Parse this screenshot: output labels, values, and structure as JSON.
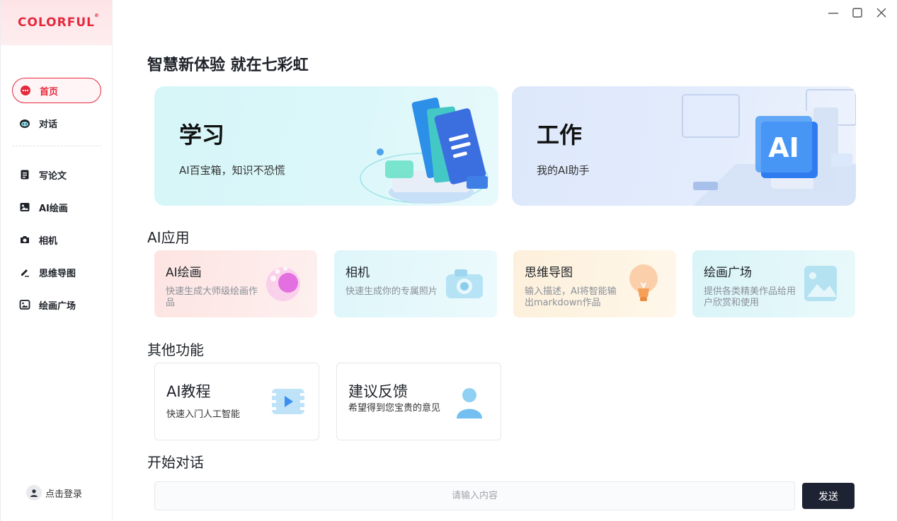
{
  "brand": {
    "logo_text": "COLORFUL",
    "logo_mark": "®",
    "accent": "#e5293d"
  },
  "sidebar": {
    "items": [
      {
        "label": "首页",
        "icon": "chat-bubble-icon",
        "active": true
      },
      {
        "label": "对话",
        "icon": "robot-icon",
        "active": false
      },
      {
        "label": "写论文",
        "icon": "document-icon",
        "active": false
      },
      {
        "label": "AI绘画",
        "icon": "image-icon",
        "active": false
      },
      {
        "label": "相机",
        "icon": "camera-icon",
        "active": false
      },
      {
        "label": "思维导图",
        "icon": "pen-icon",
        "active": false
      },
      {
        "label": "绘画广场",
        "icon": "gallery-icon",
        "active": false
      }
    ],
    "login_label": "点击登录"
  },
  "window": {
    "controls": [
      "minimize-icon",
      "maximize-icon",
      "close-icon"
    ]
  },
  "main": {
    "headline": "智慧新体验 就在七彩虹",
    "hero_cards": [
      {
        "title": "学习",
        "subtitle": "AI百宝箱，知识不恐慌"
      },
      {
        "title": "工作",
        "subtitle": "我的AI助手",
        "art_text": "AI"
      }
    ],
    "ai_apps_title": "AI应用",
    "ai_apps": [
      {
        "title": "AI绘画",
        "desc": "快速生成大师级绘画作品",
        "icon": "palette-icon"
      },
      {
        "title": "相机",
        "desc": "快速生成你的专属照片",
        "icon": "camera-icon"
      },
      {
        "title": "思维导图",
        "desc": "输入描述，AI将智能输出markdown作品",
        "icon": "lightbulb-icon"
      },
      {
        "title": "绘画广场",
        "desc": "提供各类精美作品给用户欣赏和使用",
        "icon": "picture-icon"
      }
    ],
    "other_title": "其他功能",
    "other_functions": [
      {
        "title": "AI教程",
        "desc": "快速入门人工智能",
        "icon": "video-icon"
      },
      {
        "title": "建议反馈",
        "desc": "希望得到您宝贵的意见",
        "icon": "user-icon"
      }
    ],
    "chat_title": "开始对话",
    "chat_placeholder": "请输入内容",
    "send_label": "发送"
  }
}
